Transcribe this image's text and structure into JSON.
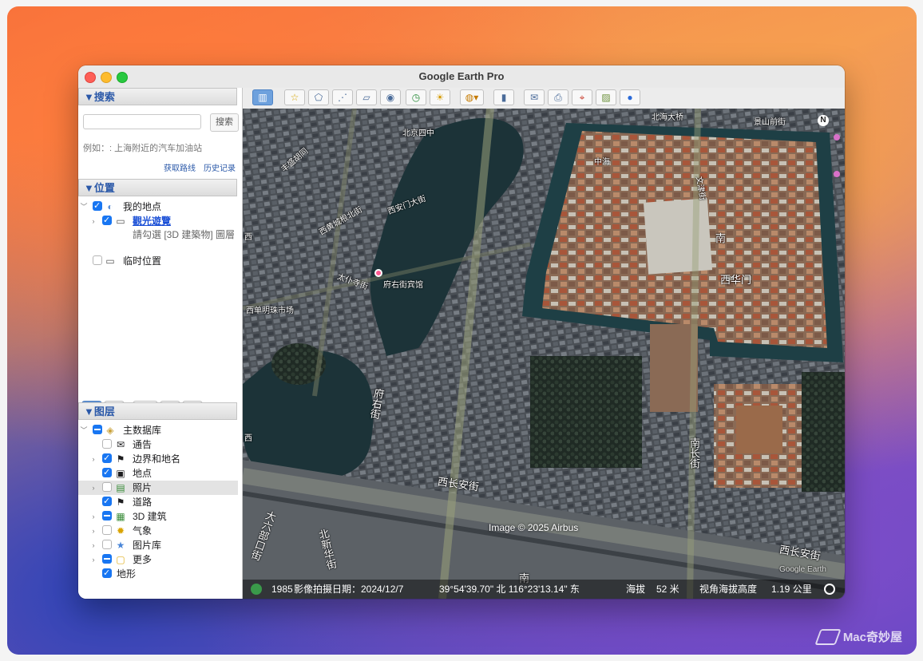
{
  "app": {
    "title": "Google Earth Pro"
  },
  "search": {
    "header": "▼搜索",
    "button": "搜索",
    "input_value": "",
    "hint": "例如：: 上海附近的汽车加油站",
    "link_route": "获取路线",
    "link_history": "历史记录"
  },
  "places": {
    "header": "▼位置",
    "items": [
      {
        "label": "我的地点"
      },
      {
        "label": "觀光遊覽"
      },
      {
        "label": "請勾選 [3D 建築物] 圖層"
      },
      {
        "label": "临时位置"
      }
    ]
  },
  "layers": {
    "header": "▼图层",
    "items": [
      {
        "label": "主数据库"
      },
      {
        "label": "通告"
      },
      {
        "label": "边界和地名"
      },
      {
        "label": "地点"
      },
      {
        "label": "照片"
      },
      {
        "label": "道路"
      },
      {
        "label": "3D 建筑"
      },
      {
        "label": "气象"
      },
      {
        "label": "图片库"
      },
      {
        "label": "更多"
      },
      {
        "label": "地形"
      }
    ]
  },
  "toolbar": {
    "icons": [
      "sidebar-icon",
      "placemark-icon",
      "polygon-icon",
      "path-icon",
      "overlay-icon",
      "record-tour-icon",
      "historical-imagery-icon",
      "sunlight-icon",
      "planets-icon",
      "ruler-icon",
      "email-icon",
      "print-icon",
      "save-image-icon",
      "view-in-maps-icon",
      "earth-icon"
    ]
  },
  "map": {
    "labels": {
      "l1": "北京四中",
      "l2": "北海大桥",
      "l3": "景山前街",
      "l4": "中海",
      "l5": "西华门",
      "l6": "西单明珠市场",
      "l7": "府右街宾馆",
      "l8": "府右街",
      "l9": "南长街",
      "l10": "西长安街",
      "l11": "西长安街",
      "l12": "北新华街",
      "l13": "大六部口街",
      "l14": "太仆寺街",
      "l15": "西黄城根北街",
      "l16": "丰盛胡同",
      "l17": "西安门大街",
      "l18": "西",
      "l19": "西",
      "l20": "文津街",
      "l21": "南",
      "l22": "南"
    },
    "compass": "N",
    "copyright": "Image © 2025 Airbus",
    "google": "Google Earth"
  },
  "status": {
    "year": "1985",
    "date": "影像拍摄日期：2024/12/7",
    "coords": "39°54'39.70\" 北  116°23'13.14\" 东",
    "elev_label": "海拔",
    "elev": "52 米",
    "eye_label": "视角海拔高度",
    "eye": "1.19 公里"
  },
  "watermark": "Mac奇妙屋",
  "colors": {
    "accent": "#1876f2",
    "link": "#2a58a8",
    "moat": "#1e3f45"
  }
}
